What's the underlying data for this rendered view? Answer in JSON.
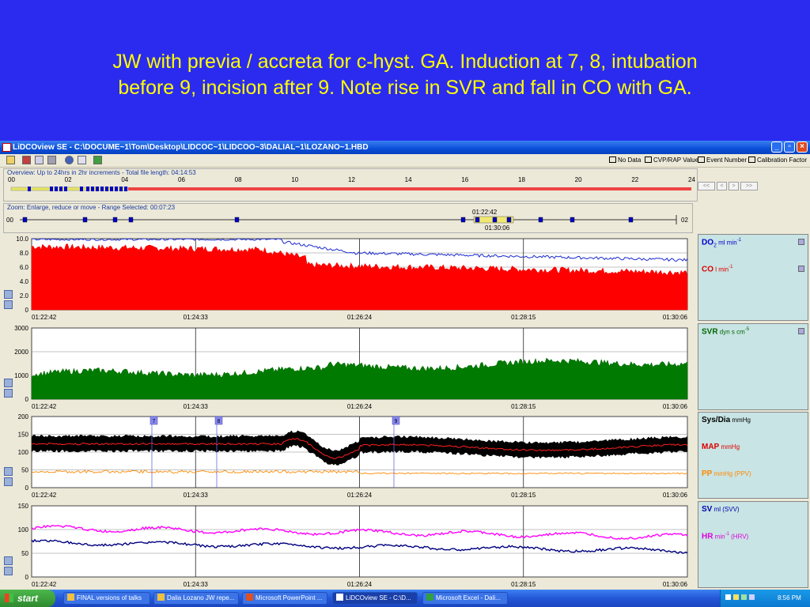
{
  "slide": {
    "title_line1": "JW with previa / accreta for c-hyst. GA. Induction at 7, 8, intubation",
    "title_line2": "before 9, incision after 9. Note rise in SVR and fall in CO with GA."
  },
  "window": {
    "title": "LiDCOview SE - C:\\DOCUME~1\\Tom\\Desktop\\LIDCOC~1\\LIDCOO~3\\DALIAL~1\\LOZANO~1.HBD",
    "colors": {
      "titlebar": "#0a4fd8",
      "body": "#ece9d8"
    }
  },
  "toolbar_legend": [
    {
      "label": "No Data",
      "color": "#ffffff"
    },
    {
      "label": "CVP/RAP Value",
      "color": "#ff00ff"
    },
    {
      "label": "Event Number",
      "color": "#0000cc"
    },
    {
      "label": "Calibration Factor",
      "color": "#00ffff"
    }
  ],
  "overview": {
    "label": "Overview: Up to 24hrs in 2hr increments - Total file length: 04:14:53",
    "ticks": [
      "00",
      "02",
      "04",
      "06",
      "08",
      "10",
      "12",
      "14",
      "16",
      "18",
      "20",
      "22",
      "24"
    ],
    "nav": [
      "<<",
      "<",
      ">",
      ">>"
    ]
  },
  "zoom": {
    "label": "Zoom: Enlarge, reduce or move - Range Selected: 00:07:23",
    "start": "00",
    "end": "02",
    "sel_start": "01:22:42",
    "sel_end": "01:30:06"
  },
  "x_ticks": [
    "01:22:42",
    "01:24:33",
    "01:26:24",
    "01:28:15",
    "01:30:06"
  ],
  "charts": [
    {
      "yticks": [
        "10.0",
        "8.0",
        "6.0",
        "4.0",
        "2.0",
        "0"
      ]
    },
    {
      "yticks": [
        "3000",
        "2000",
        "1000",
        "0"
      ]
    },
    {
      "yticks": [
        "200",
        "150",
        "100",
        "50",
        "0"
      ]
    },
    {
      "yticks": [
        "150",
        "100",
        "50",
        "0"
      ]
    }
  ],
  "events": [
    "7",
    "8",
    "9"
  ],
  "sidebars": [
    {
      "items": [
        {
          "name": "DO",
          "sub": "2",
          "unit": " ml min",
          "sup": "-1",
          "color": "#0000cc"
        },
        {
          "name": "CO",
          "unit": " l min",
          "sup": "-1",
          "color": "#dd0000"
        }
      ]
    },
    {
      "items": [
        {
          "name": "SVR",
          "unit": " dyn s cm",
          "sup": "-5",
          "color": "#006600"
        }
      ]
    },
    {
      "items": [
        {
          "name": "Sys/Dia",
          "unit": " mmHg",
          "color": "#000000"
        },
        {
          "name": "MAP",
          "unit": " mmHg",
          "color": "#dd0000"
        },
        {
          "name": "PP",
          "unit": " mmHg (PPV)",
          "color": "#ff8800"
        }
      ]
    },
    {
      "items": [
        {
          "name": "SV",
          "unit": " ml (SVV)",
          "color": "#0000aa"
        },
        {
          "name": "HR",
          "unit": " min",
          "sup": "-1",
          "unit2": " (HRV)",
          "color": "#dd00dd"
        }
      ]
    }
  ],
  "taskbar": {
    "start": "start",
    "buttons": [
      "FINAL versions of talks",
      "Dalia Lozano JW repe...",
      "Microsoft PowerPoint ...",
      "LiDCOview SE - C:\\D...",
      "Microsoft Excel - Dali..."
    ],
    "clock": "8:56 PM"
  }
}
